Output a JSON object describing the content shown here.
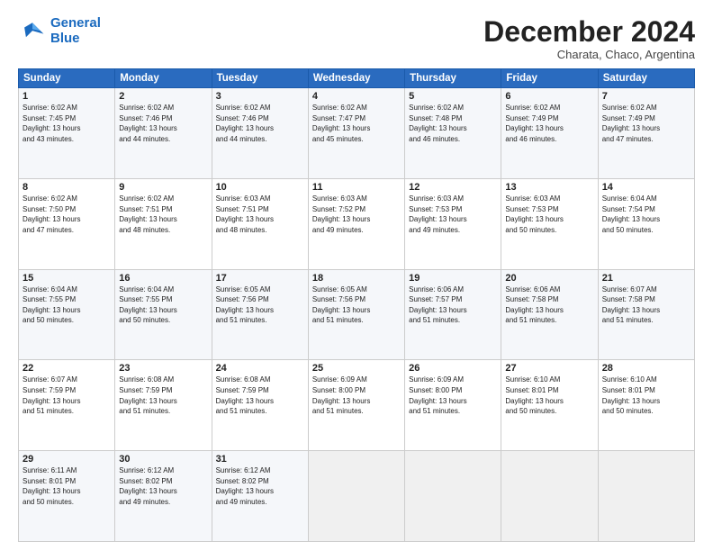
{
  "logo": {
    "line1": "General",
    "line2": "Blue"
  },
  "title": "December 2024",
  "subtitle": "Charata, Chaco, Argentina",
  "header_days": [
    "Sunday",
    "Monday",
    "Tuesday",
    "Wednesday",
    "Thursday",
    "Friday",
    "Saturday"
  ],
  "weeks": [
    [
      {
        "day": "1",
        "info": "Sunrise: 6:02 AM\nSunset: 7:45 PM\nDaylight: 13 hours\nand 43 minutes."
      },
      {
        "day": "2",
        "info": "Sunrise: 6:02 AM\nSunset: 7:46 PM\nDaylight: 13 hours\nand 44 minutes."
      },
      {
        "day": "3",
        "info": "Sunrise: 6:02 AM\nSunset: 7:46 PM\nDaylight: 13 hours\nand 44 minutes."
      },
      {
        "day": "4",
        "info": "Sunrise: 6:02 AM\nSunset: 7:47 PM\nDaylight: 13 hours\nand 45 minutes."
      },
      {
        "day": "5",
        "info": "Sunrise: 6:02 AM\nSunset: 7:48 PM\nDaylight: 13 hours\nand 46 minutes."
      },
      {
        "day": "6",
        "info": "Sunrise: 6:02 AM\nSunset: 7:49 PM\nDaylight: 13 hours\nand 46 minutes."
      },
      {
        "day": "7",
        "info": "Sunrise: 6:02 AM\nSunset: 7:49 PM\nDaylight: 13 hours\nand 47 minutes."
      }
    ],
    [
      {
        "day": "8",
        "info": "Sunrise: 6:02 AM\nSunset: 7:50 PM\nDaylight: 13 hours\nand 47 minutes."
      },
      {
        "day": "9",
        "info": "Sunrise: 6:02 AM\nSunset: 7:51 PM\nDaylight: 13 hours\nand 48 minutes."
      },
      {
        "day": "10",
        "info": "Sunrise: 6:03 AM\nSunset: 7:51 PM\nDaylight: 13 hours\nand 48 minutes."
      },
      {
        "day": "11",
        "info": "Sunrise: 6:03 AM\nSunset: 7:52 PM\nDaylight: 13 hours\nand 49 minutes."
      },
      {
        "day": "12",
        "info": "Sunrise: 6:03 AM\nSunset: 7:53 PM\nDaylight: 13 hours\nand 49 minutes."
      },
      {
        "day": "13",
        "info": "Sunrise: 6:03 AM\nSunset: 7:53 PM\nDaylight: 13 hours\nand 50 minutes."
      },
      {
        "day": "14",
        "info": "Sunrise: 6:04 AM\nSunset: 7:54 PM\nDaylight: 13 hours\nand 50 minutes."
      }
    ],
    [
      {
        "day": "15",
        "info": "Sunrise: 6:04 AM\nSunset: 7:55 PM\nDaylight: 13 hours\nand 50 minutes."
      },
      {
        "day": "16",
        "info": "Sunrise: 6:04 AM\nSunset: 7:55 PM\nDaylight: 13 hours\nand 50 minutes."
      },
      {
        "day": "17",
        "info": "Sunrise: 6:05 AM\nSunset: 7:56 PM\nDaylight: 13 hours\nand 51 minutes."
      },
      {
        "day": "18",
        "info": "Sunrise: 6:05 AM\nSunset: 7:56 PM\nDaylight: 13 hours\nand 51 minutes."
      },
      {
        "day": "19",
        "info": "Sunrise: 6:06 AM\nSunset: 7:57 PM\nDaylight: 13 hours\nand 51 minutes."
      },
      {
        "day": "20",
        "info": "Sunrise: 6:06 AM\nSunset: 7:58 PM\nDaylight: 13 hours\nand 51 minutes."
      },
      {
        "day": "21",
        "info": "Sunrise: 6:07 AM\nSunset: 7:58 PM\nDaylight: 13 hours\nand 51 minutes."
      }
    ],
    [
      {
        "day": "22",
        "info": "Sunrise: 6:07 AM\nSunset: 7:59 PM\nDaylight: 13 hours\nand 51 minutes."
      },
      {
        "day": "23",
        "info": "Sunrise: 6:08 AM\nSunset: 7:59 PM\nDaylight: 13 hours\nand 51 minutes."
      },
      {
        "day": "24",
        "info": "Sunrise: 6:08 AM\nSunset: 7:59 PM\nDaylight: 13 hours\nand 51 minutes."
      },
      {
        "day": "25",
        "info": "Sunrise: 6:09 AM\nSunset: 8:00 PM\nDaylight: 13 hours\nand 51 minutes."
      },
      {
        "day": "26",
        "info": "Sunrise: 6:09 AM\nSunset: 8:00 PM\nDaylight: 13 hours\nand 51 minutes."
      },
      {
        "day": "27",
        "info": "Sunrise: 6:10 AM\nSunset: 8:01 PM\nDaylight: 13 hours\nand 50 minutes."
      },
      {
        "day": "28",
        "info": "Sunrise: 6:10 AM\nSunset: 8:01 PM\nDaylight: 13 hours\nand 50 minutes."
      }
    ],
    [
      {
        "day": "29",
        "info": "Sunrise: 6:11 AM\nSunset: 8:01 PM\nDaylight: 13 hours\nand 50 minutes."
      },
      {
        "day": "30",
        "info": "Sunrise: 6:12 AM\nSunset: 8:02 PM\nDaylight: 13 hours\nand 49 minutes."
      },
      {
        "day": "31",
        "info": "Sunrise: 6:12 AM\nSunset: 8:02 PM\nDaylight: 13 hours\nand 49 minutes."
      },
      null,
      null,
      null,
      null
    ]
  ]
}
